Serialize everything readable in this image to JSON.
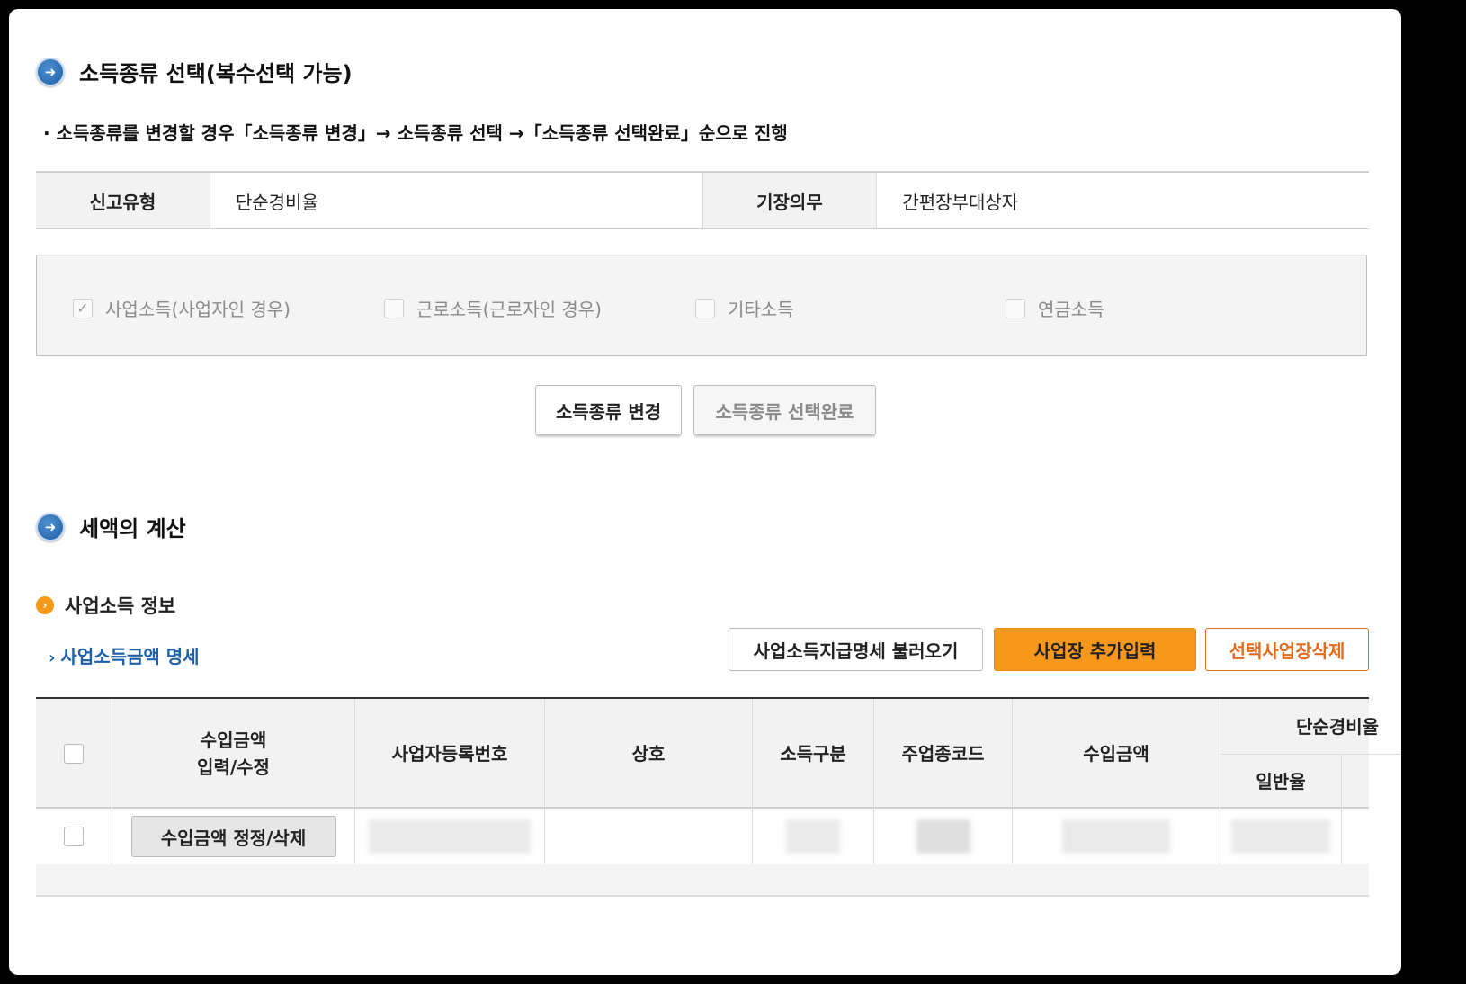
{
  "income_section": {
    "title": "소득종류 선택(복수선택 가능)",
    "notice": "· 소득종류를 변경할 경우「소득종류 변경」→ 소득종류 선택 →「소득종류 선택완료」순으로 진행",
    "info": {
      "report_type_label": "신고유형",
      "report_type_value": "단순경비율",
      "bookkeeping_label": "기장의무",
      "bookkeeping_value": "간편장부대상자"
    },
    "checkboxes": [
      {
        "label": "사업소득(사업자인 경우)",
        "checked": true
      },
      {
        "label": "근로소득(근로자인 경우)",
        "checked": false
      },
      {
        "label": "기타소득",
        "checked": false
      },
      {
        "label": "연금소득",
        "checked": false
      }
    ],
    "change_button": "소득종류 변경",
    "complete_button": "소득종류 선택완료"
  },
  "tax_section": {
    "title": "세액의 계산",
    "subtitle": "사업소득 정보",
    "detail_link": "사업소득금액 명세",
    "buttons": {
      "load": "사업소득지급명세 불러오기",
      "add": "사업장 추가입력",
      "delete": "선택사업장삭제"
    },
    "table": {
      "headers": {
        "income_edit": "수입금액\n입력/수정",
        "biz_reg_no": "사업자등록번호",
        "trade_name": "상호",
        "income_type": "소득구분",
        "industry_code": "주업종코드",
        "revenue": "수입금액",
        "simple_rate": "단순경비율",
        "general_rate": "일반율"
      },
      "row_button": "수입금액 정정/삭제"
    }
  },
  "colors": {
    "accent_orange": "#f59a1a",
    "delete_orange": "#e36b1c",
    "link_blue": "#1d5fa8"
  }
}
